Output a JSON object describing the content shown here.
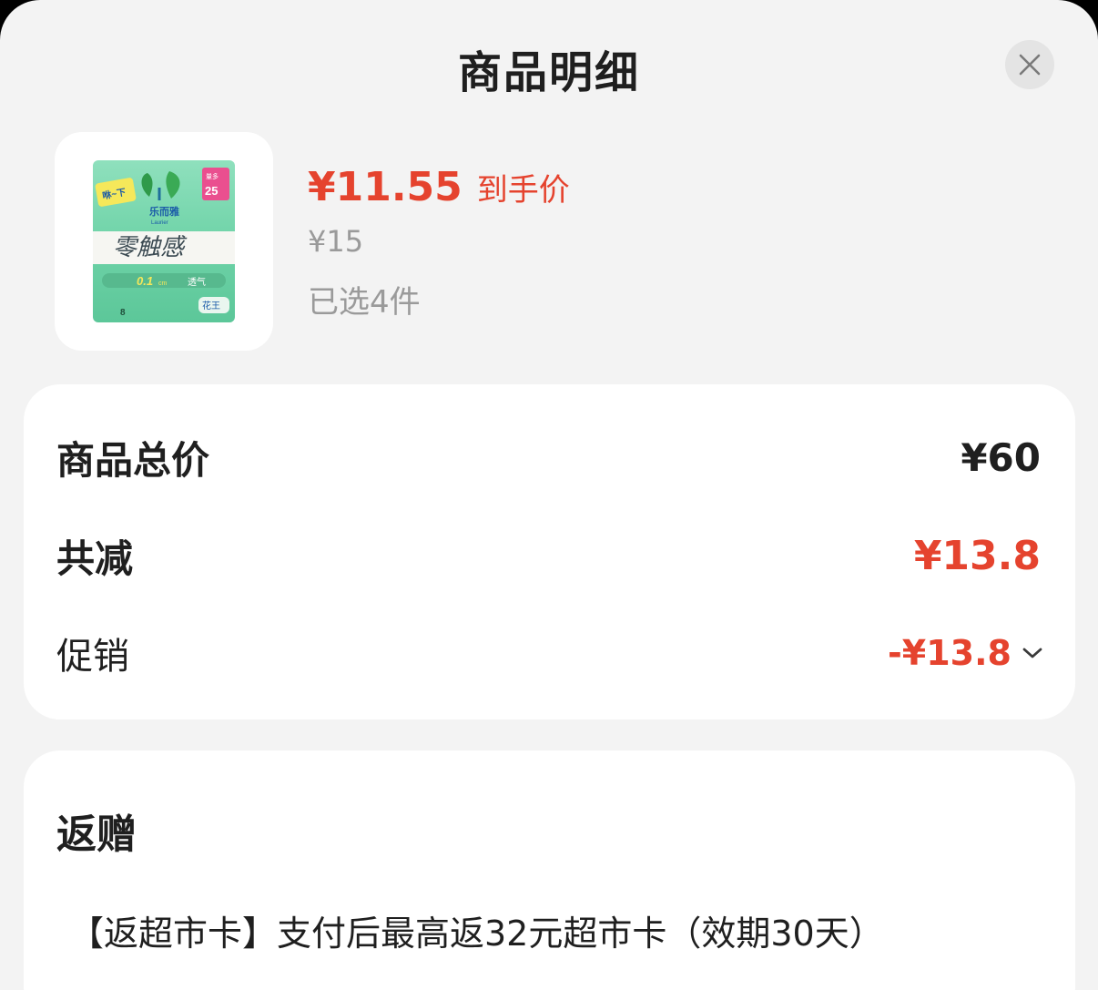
{
  "sheet": {
    "title": "商品明细"
  },
  "product": {
    "price": "¥11.55",
    "price_tag": "到手价",
    "original_price": "¥15",
    "selected_count": "已选4件",
    "image_texts": {
      "brand": "乐而雅",
      "brand_en": "Laurier",
      "name": "零触感",
      "badge_top": "量多",
      "badge_num": "25",
      "feature": "0.1",
      "feature_unit": "cm",
      "feature_word": "透气",
      "sticker": "咻~下",
      "count": "8",
      "maker": "花王"
    }
  },
  "summary": {
    "total_label": "商品总价",
    "total_value": "¥60",
    "discount_label": "共减",
    "discount_value": "¥13.8",
    "promo_label": "促销",
    "promo_value": "-¥13.8"
  },
  "gift": {
    "title": "返赠",
    "description": "【返超市卡】支付后最高返32元超市卡（效期30天）"
  },
  "colors": {
    "accent_red": "#e5432e",
    "sheet_bg": "#f3f3f3",
    "card_bg": "#ffffff",
    "muted_text": "#9a9a9a",
    "package_green": "#6fd3a8"
  },
  "icons": {
    "close": "close-icon",
    "expand": "chevron-down-icon"
  }
}
